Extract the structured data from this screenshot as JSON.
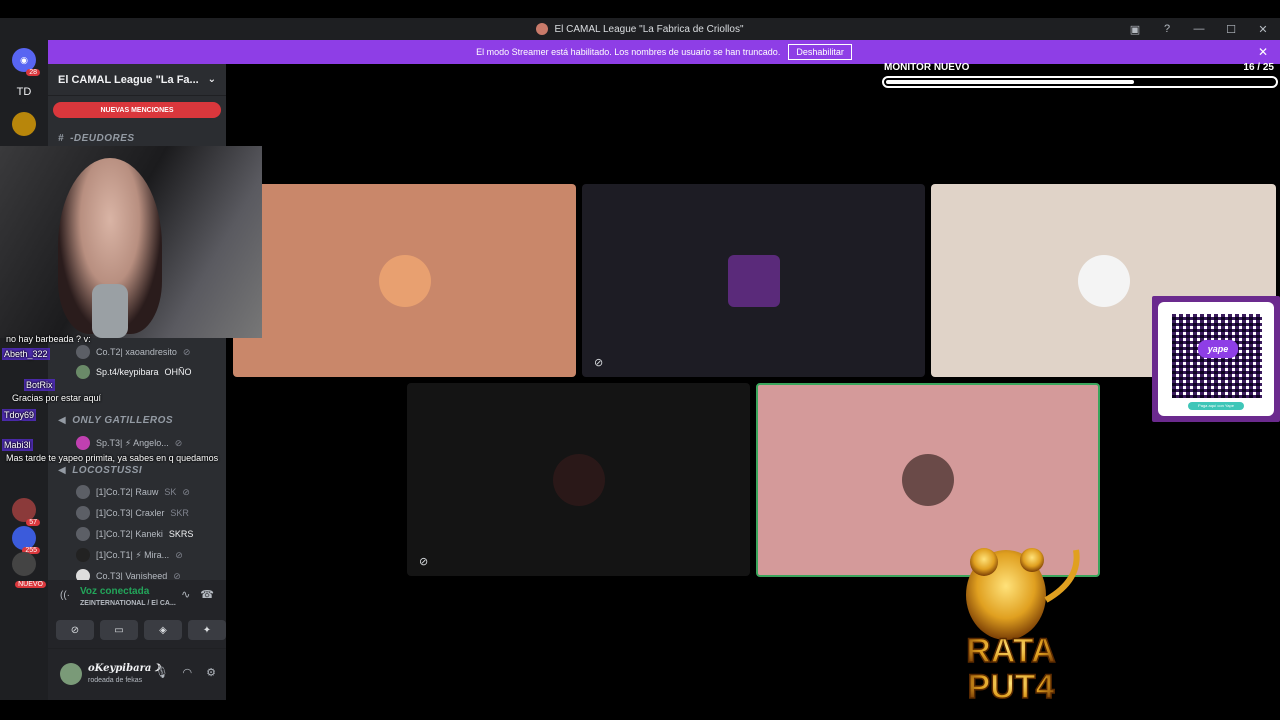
{
  "window": {
    "title": "El CAMAL League \"La Fabrica de Criollos\""
  },
  "streamer_banner": {
    "message": "El modo Streamer está habilitado. Los nombres de usuario se han truncado.",
    "button": "Deshabilitar"
  },
  "server_rail": {
    "items": [
      {
        "label": "",
        "badge": "28"
      },
      {
        "label": "TD",
        "badge": ""
      },
      {
        "label": "",
        "badge": ""
      },
      {
        "label": "",
        "badge": "57"
      },
      {
        "label": "",
        "badge": "255"
      },
      {
        "label": "",
        "badge": "NUEVO"
      }
    ]
  },
  "sidebar": {
    "server_name": "El CAMAL League \"La Fa...",
    "new_mentions": "NUEVAS MENCIONES",
    "channel_deudores": "-DEUDORES",
    "cat_gatilleros": "ONLY GATILLEROS",
    "cat_locostussi": "LOCOSTUSSI",
    "users": [
      {
        "name": "Co.T2| xaoandresito"
      },
      {
        "name": "Sp.t4/keypibara",
        "tag": "OHÑO"
      },
      {
        "name": "Sp.T3| ⚡ Angelo..."
      },
      {
        "name": "[1]Co.T2| Rauw",
        "tag": "SK"
      },
      {
        "name": "[1]Co.T3| Craxler",
        "tag": "SKR"
      },
      {
        "name": "[1]Co.T2| Kaneki",
        "tag": "SKRS"
      },
      {
        "name": "[1]Co.T1| ⚡ Mira..."
      },
      {
        "name": "Co.T3| Vanisheed"
      }
    ]
  },
  "voice_panel": {
    "status": "Voz conectada",
    "subtitle": "ZEINTERNATIONAL / El CA..."
  },
  "user_panel": {
    "username": "ᴏKeypibara☽",
    "status": "rodeada de fekas"
  },
  "chat_overlay": {
    "lines": [
      {
        "text": "no hay barbeada ? v:"
      },
      {
        "text": "Abeth_322",
        "is_name": true
      },
      {
        "text": "BotRix",
        "is_name": true
      },
      {
        "text": "Gracias por estar aquí"
      },
      {
        "text": "Tdoy69",
        "is_name": true
      },
      {
        "text": "Mabi3l",
        "is_name": true
      },
      {
        "text": "Mas tarde te yapeo primita, ya sabes en q quedamos"
      }
    ]
  },
  "monitor": {
    "label": "MONITOR NUEVO",
    "value": "16  / 25",
    "progress": 0.64
  },
  "tiles": [
    {
      "name": "tile-1",
      "bg": "#c9876a"
    },
    {
      "name": "tile-2",
      "bg": "#1d1c24"
    },
    {
      "name": "tile-3",
      "bg": "#e0d3c8"
    },
    {
      "name": "tile-4",
      "bg": "#141414"
    },
    {
      "name": "tile-5",
      "bg": "#d49a9a"
    }
  ],
  "qr": {
    "brand": "yape",
    "caption": "Paga aquí con Yape"
  },
  "logo": {
    "text": "RATA PUT4"
  },
  "colors": {
    "banner": "#8e3ee6",
    "mentions": "#da373c",
    "voice_connected": "#23a55a",
    "speaking_border": "#3ba55d"
  }
}
